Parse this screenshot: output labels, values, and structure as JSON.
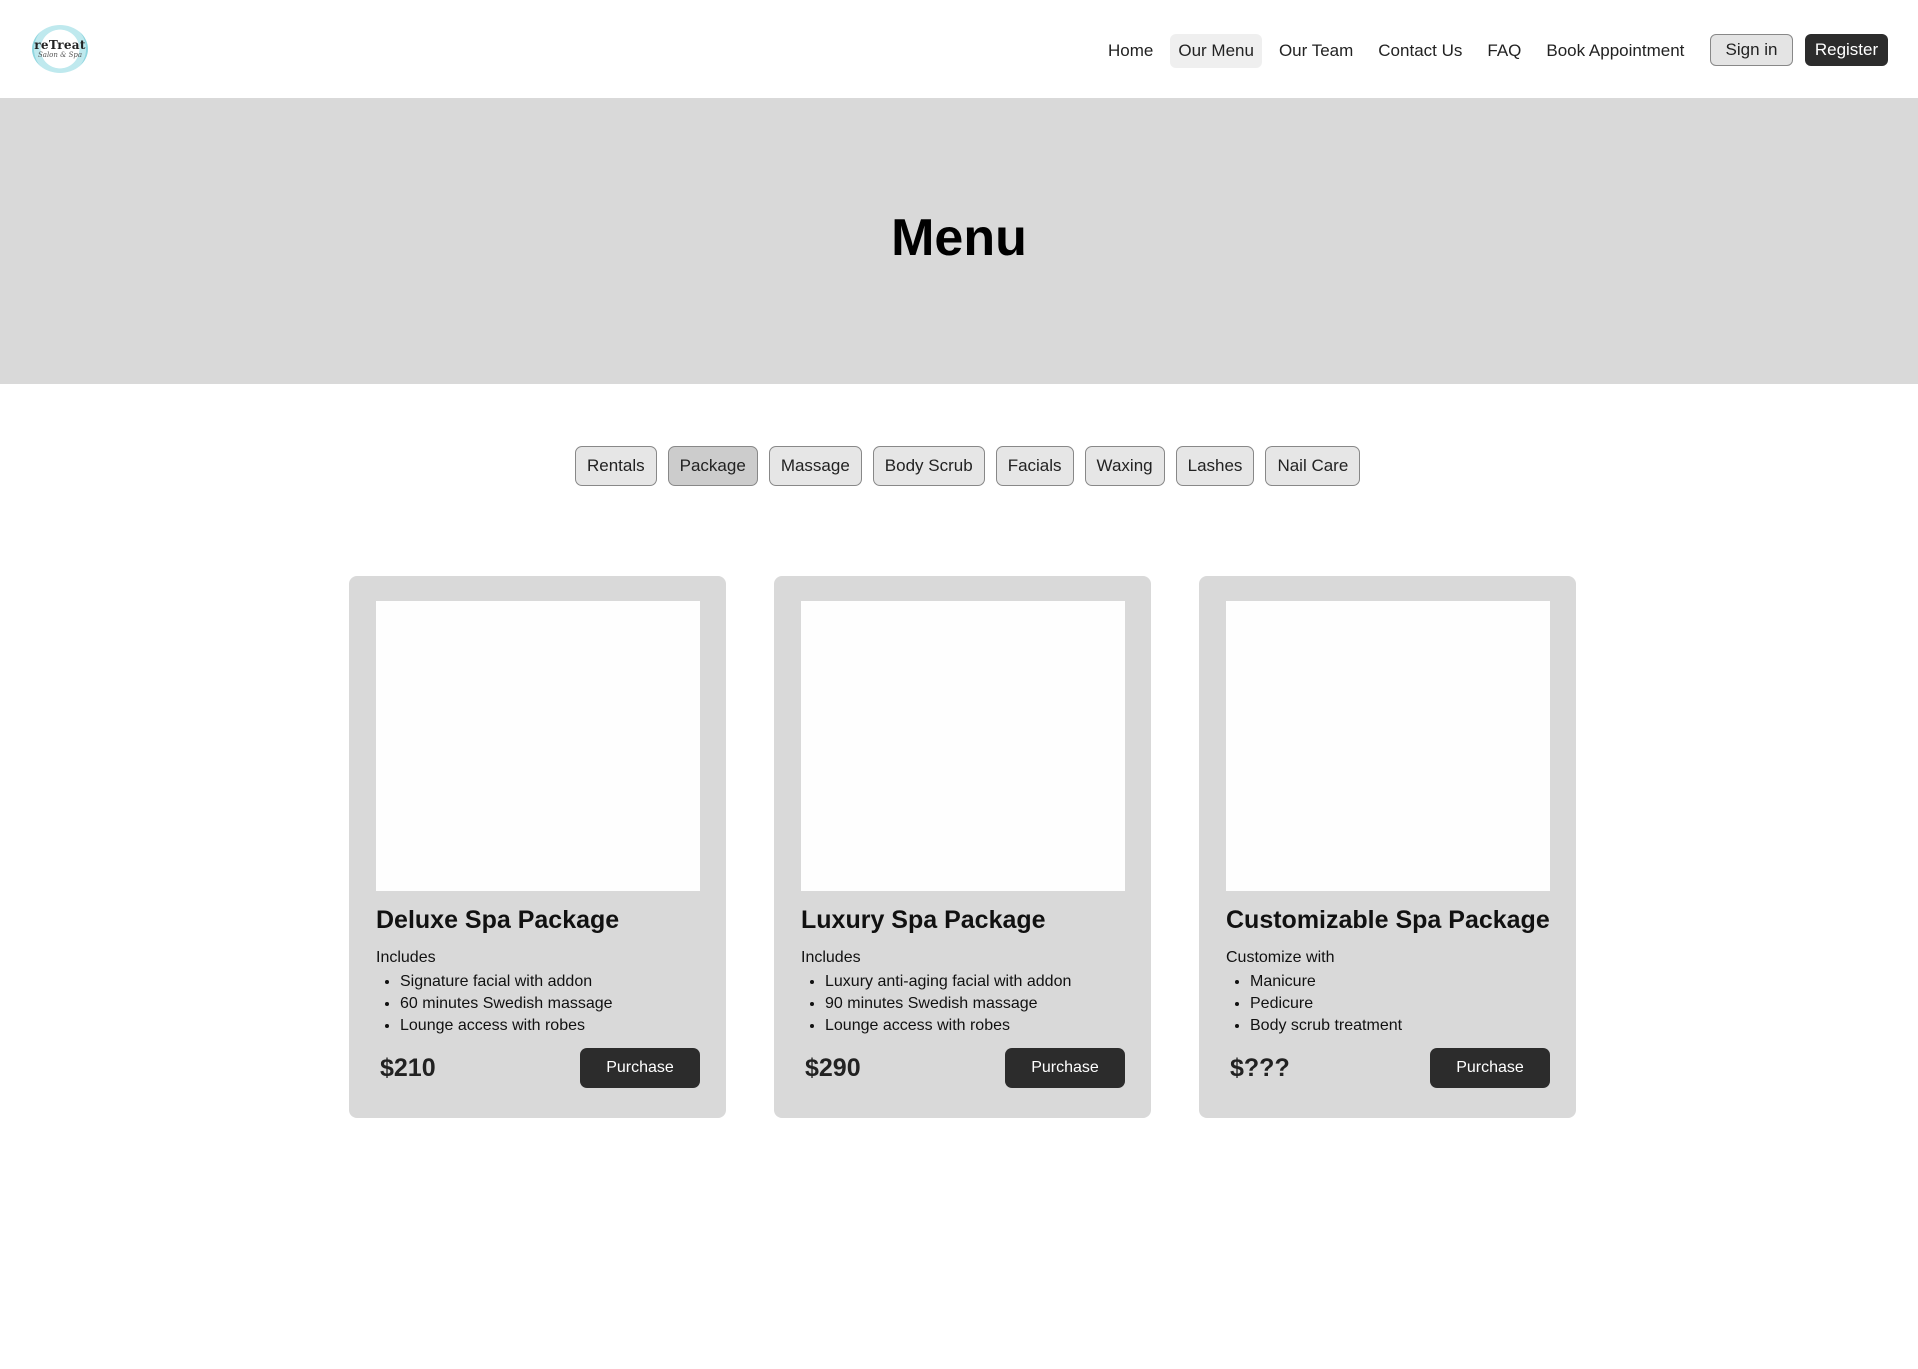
{
  "logo": {
    "name": "reTreat",
    "sub": "Salon & Spa"
  },
  "nav": {
    "items": [
      "Home",
      "Our Menu",
      "Our Team",
      "Contact Us",
      "FAQ",
      "Book Appointment"
    ],
    "active": "Our Menu",
    "sign_in": "Sign in",
    "register": "Register"
  },
  "hero": {
    "title": "Menu"
  },
  "filters": {
    "items": [
      "Rentals",
      "Package",
      "Massage",
      "Body Scrub",
      "Facials",
      "Waxing",
      "Lashes",
      "Nail Care"
    ],
    "selected": "Package"
  },
  "cards": [
    {
      "title": "Deluxe Spa Package",
      "intro": "Includes",
      "items": [
        "Signature facial with addon",
        "60 minutes Swedish massage",
        "Lounge access with robes"
      ],
      "price": "$210",
      "button": "Purchase"
    },
    {
      "title": "Luxury Spa Package",
      "intro": "Includes",
      "items": [
        "Luxury anti-aging facial with addon",
        "90 minutes Swedish massage",
        "Lounge access with robes"
      ],
      "price": "$290",
      "button": "Purchase"
    },
    {
      "title": "Customizable Spa Package",
      "intro": "Customize with",
      "items": [
        "Manicure",
        "Pedicure",
        "Body scrub treatment"
      ],
      "price": "$???",
      "button": "Purchase"
    }
  ]
}
